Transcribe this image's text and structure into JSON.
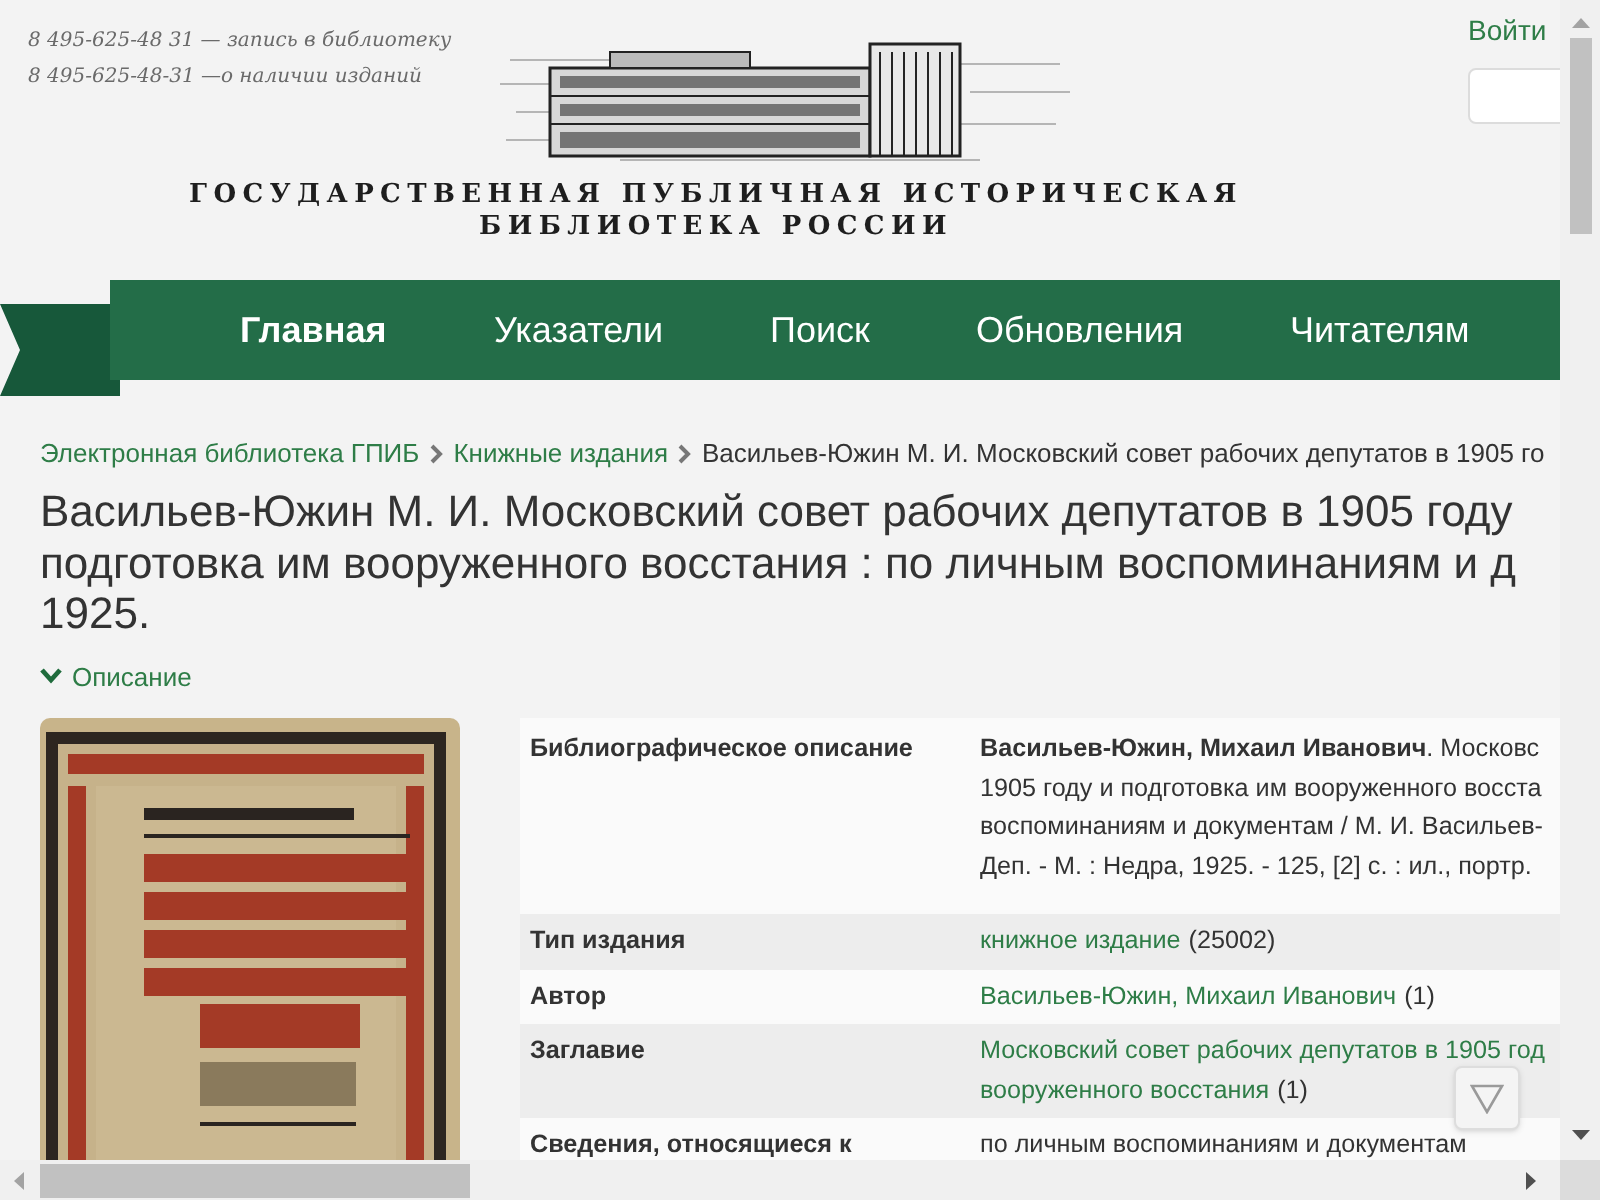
{
  "header": {
    "phones": [
      "8 495-625-48 31 — запись в библиотеку",
      "8 495-625-48-31 —о наличии изданий"
    ],
    "library_name": [
      "ГОСУДАРСТВЕННАЯ ПУБЛИЧНАЯ ИСТОРИЧЕСКАЯ",
      "БИБЛИОТЕКА РОССИИ"
    ],
    "login": "Войти"
  },
  "nav": [
    {
      "label": "Главная",
      "selected": true
    },
    {
      "label": "Указатели",
      "selected": false
    },
    {
      "label": "Поиск",
      "selected": false
    },
    {
      "label": "Обновления",
      "selected": false
    },
    {
      "label": "Читателям",
      "selected": false
    }
  ],
  "breadcrumb": [
    {
      "label": "Электронная библиотека ГПИБ",
      "link": true
    },
    {
      "label": "Книжные издания",
      "link": true
    },
    {
      "label": "Васильев-Южин М. И. Московский совет рабочих депутатов в 1905 го",
      "link": false
    }
  ],
  "title_lines": [
    "Васильев-Южин М. И. Московский совет рабочих депутатов в 1905 году",
    "подготовка им вооруженного восстания : по личным воспоминаниям и д",
    "1925."
  ],
  "description_toggle": {
    "label": "Описание",
    "expanded": true
  },
  "cover": {
    "kind": "picture"
  },
  "details": [
    {
      "label": "Библиографическое описание",
      "lines": [
        [
          {
            "text": "**Васильев-Южин, Михаил Иванович**. Московс",
            "link": false
          }
        ],
        [
          {
            "text": "1905 году и подготовка им вооруженного восста",
            "link": false
          }
        ],
        [
          {
            "text": "воспоминаниям и документам / М. И. Васильев-",
            "link": false
          }
        ],
        [
          {
            "text": "Деп. - М. : Недра, 1925. - 125, [2] с. : ил., портр.",
            "link": false
          }
        ]
      ]
    },
    {
      "label": "Тип издания",
      "lines": [
        [
          {
            "text": "книжное издание",
            "link": true
          },
          {
            "text": "(25002)",
            "link": false
          }
        ]
      ]
    },
    {
      "label": "Автор",
      "lines": [
        [
          {
            "text": "Васильев-Южин, Михаил Иванович",
            "link": true
          },
          {
            "text": "(1)",
            "link": false
          }
        ]
      ]
    },
    {
      "label": "Заглавие",
      "lines": [
        [
          {
            "text": "Московский совет рабочих депутатов в 1905 год",
            "link": true
          }
        ],
        [
          {
            "text": "вооруженного восстания",
            "link": true
          },
          {
            "text": "(1)",
            "link": false
          }
        ]
      ]
    },
    {
      "label": "Сведения, относящиеся к",
      "lines": [
        [
          {
            "text": "по личным воспоминаниям и документам",
            "link": false
          }
        ]
      ]
    }
  ]
}
